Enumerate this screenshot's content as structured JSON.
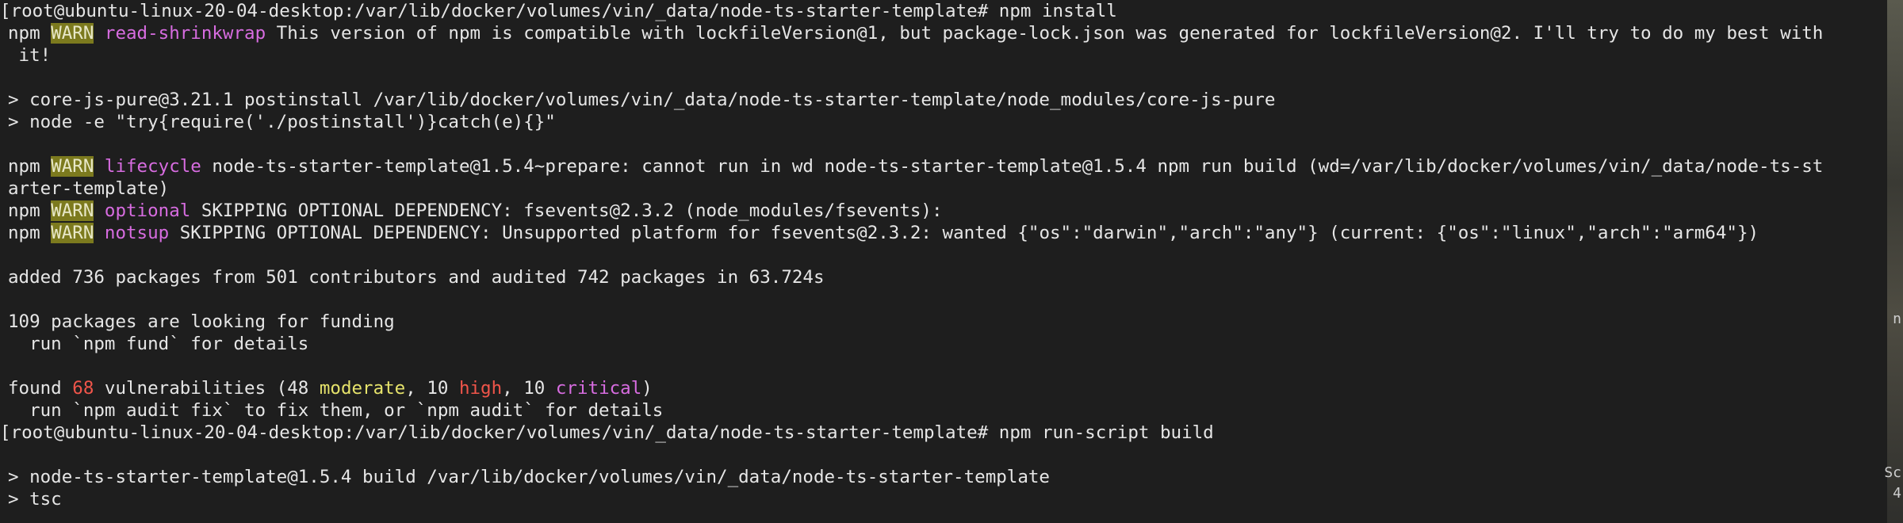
{
  "terminal": {
    "l1_prompt": "[root@ubuntu-linux-20-04-desktop:/var/lib/docker/volumes/vin/_data/node-ts-starter-template# npm install",
    "npm": "npm",
    "warn": "WARN",
    "l2_tag": "read-shrinkwrap",
    "l2_msg": " This version of npm is compatible with lockfileVersion@1, but package-lock.json was generated for lockfileVersion@2. I'll try to do my best with",
    "l3": " it!",
    "l5": "> core-js-pure@3.21.1 postinstall /var/lib/docker/volumes/vin/_data/node-ts-starter-template/node_modules/core-js-pure",
    "l6": "> node -e \"try{require('./postinstall')}catch(e){}\"",
    "l8_tag": "lifecycle",
    "l8_msg": " node-ts-starter-template@1.5.4~prepare: cannot run in wd node-ts-starter-template@1.5.4 npm run build (wd=/var/lib/docker/volumes/vin/_data/node-ts-st",
    "l9": "arter-template)",
    "l10_tag": "optional",
    "l10_msg": " SKIPPING OPTIONAL DEPENDENCY: fsevents@2.3.2 (node_modules/fsevents):",
    "l11_tag": "notsup",
    "l11_msg": " SKIPPING OPTIONAL DEPENDENCY: Unsupported platform for fsevents@2.3.2: wanted {\"os\":\"darwin\",\"arch\":\"any\"} (current: {\"os\":\"linux\",\"arch\":\"arm64\"})",
    "l13": "added 736 packages from 501 contributors and audited 742 packages in 63.724s",
    "l15": "109 packages are looking for funding",
    "l16": "  run `npm fund` for details",
    "l18_a": "found ",
    "l18_count": "68",
    "l18_b": " vulnerabilities (48 ",
    "l18_moderate": "moderate",
    "l18_c": ", 10 ",
    "l18_high": "high",
    "l18_d": ", 10 ",
    "l18_critical": "critical",
    "l18_e": ")",
    "l19": "  run `npm audit fix` to fix them, or `npm audit` for details",
    "l20_prompt": "[root@ubuntu-linux-20-04-desktop:/var/lib/docker/volumes/vin/_data/node-ts-starter-template# npm run-script build",
    "l22": "> node-ts-starter-template@1.5.4 build /var/lib/docker/volumes/vin/_data/node-ts-starter-template",
    "l23": "> tsc"
  },
  "edge": {
    "g1": "n",
    "g2": "Sc",
    "g3": "4"
  },
  "colors": {
    "background": "#1e1e1e",
    "text": "#e6e6e6",
    "warn_bg": "#7c7a1e",
    "magenta": "#d76ce0",
    "yellow": "#e6e36b",
    "red": "#f0554a"
  }
}
